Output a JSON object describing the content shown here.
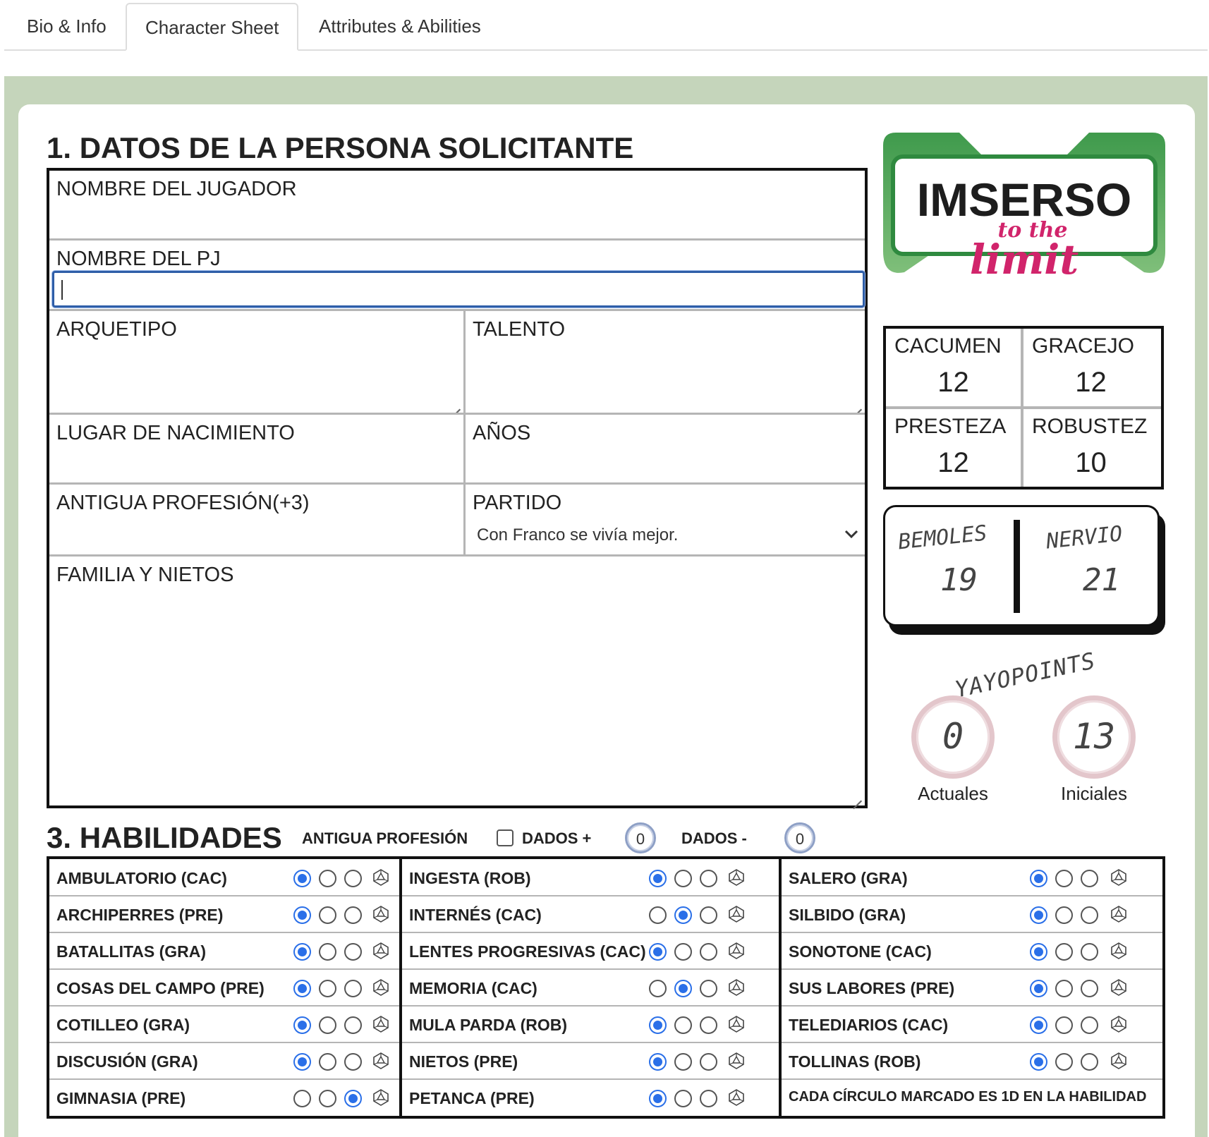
{
  "tabs": [
    {
      "label": "Bio & Info"
    },
    {
      "label": "Character Sheet"
    },
    {
      "label": "Attributes & Abilities"
    }
  ],
  "section1": {
    "title": "1. DATOS DE LA PERSONA SOLICITANTE",
    "fields": {
      "player_name": {
        "label": "NOMBRE DEL JUGADOR",
        "value": ""
      },
      "pc_name": {
        "label": "NOMBRE DEL PJ",
        "value": ""
      },
      "archetype": {
        "label": "ARQUETIPO",
        "value": ""
      },
      "talent": {
        "label": "TALENTO",
        "value": ""
      },
      "birthplace": {
        "label": "LUGAR DE NACIMIENTO",
        "value": ""
      },
      "years": {
        "label": "AÑOS",
        "value": ""
      },
      "old_profession": {
        "label": "ANTIGUA PROFESIÓN(+3)",
        "value": ""
      },
      "party": {
        "label": "PARTIDO",
        "value": "Con Franco se vivía mejor."
      },
      "family": {
        "label": "FAMILIA Y NIETOS",
        "value": ""
      }
    }
  },
  "logo": {
    "main": "IMSERSO",
    "script1": "to the",
    "script2": "limit"
  },
  "attributes": [
    {
      "label": "CACUMEN",
      "value": "12"
    },
    {
      "label": "GRACEJO",
      "value": "12"
    },
    {
      "label": "PRESTEZA",
      "value": "12"
    },
    {
      "label": "ROBUSTEZ",
      "value": "10"
    }
  ],
  "bemoles": {
    "label": "BEMOLES",
    "value": "19"
  },
  "nervio": {
    "label": "NERVIO",
    "value": "21"
  },
  "yayopoints": {
    "title": "YAYOPOINTS",
    "current": {
      "label": "Actuales",
      "value": "0"
    },
    "initial": {
      "label": "Iniciales",
      "value": "13"
    }
  },
  "section3": {
    "title": "3. HABILIDADES",
    "old_profession_label": "ANTIGUA PROFESIÓN",
    "old_profession_checked": false,
    "dice_plus_label": "DADOS +",
    "dice_plus_value": "0",
    "dice_minus_label": "DADOS -",
    "dice_minus_value": "0",
    "note": "CADA CÍRCULO MARCADO ES 1D EN LA HABILIDAD",
    "columns": [
      [
        {
          "name": "AMBULATORIO (CAC)",
          "level": 1
        },
        {
          "name": "ARCHIPERRES (PRE)",
          "level": 1
        },
        {
          "name": "BATALLITAS (GRA)",
          "level": 1
        },
        {
          "name": "COSAS DEL CAMPO (PRE)",
          "level": 1
        },
        {
          "name": "COTILLEO (GRA)",
          "level": 1
        },
        {
          "name": "DISCUSIÓN (GRA)",
          "level": 1
        },
        {
          "name": "GIMNASIA (PRE)",
          "level": 3
        }
      ],
      [
        {
          "name": "INGESTA (ROB)",
          "level": 1
        },
        {
          "name": "INTERNÉS (CAC)",
          "level": 2
        },
        {
          "name": "LENTES PROGRESIVAS (CAC)",
          "level": 1
        },
        {
          "name": "MEMORIA (CAC)",
          "level": 2
        },
        {
          "name": "MULA PARDA (ROB)",
          "level": 1
        },
        {
          "name": "NIETOS (PRE)",
          "level": 1
        },
        {
          "name": "PETANCA (PRE)",
          "level": 1
        }
      ],
      [
        {
          "name": "SALERO (GRA)",
          "level": 1
        },
        {
          "name": "SILBIDO (GRA)",
          "level": 1
        },
        {
          "name": "SONOTONE (CAC)",
          "level": 1
        },
        {
          "name": "SUS LABORES (PRE)",
          "level": 1
        },
        {
          "name": "TELEDIARIOS (CAC)",
          "level": 1
        },
        {
          "name": "TOLLINAS (ROB)",
          "level": 1
        }
      ]
    ]
  },
  "colors": {
    "band": "#c5d5bb",
    "focus": "#2f5ea8",
    "radio": "#2a6fe8",
    "logo_green": "#5aa65a",
    "logo_pink": "#d1246b"
  },
  "icons": {
    "select": "chevron-down-icon",
    "roll": "d20-dice-icon"
  }
}
